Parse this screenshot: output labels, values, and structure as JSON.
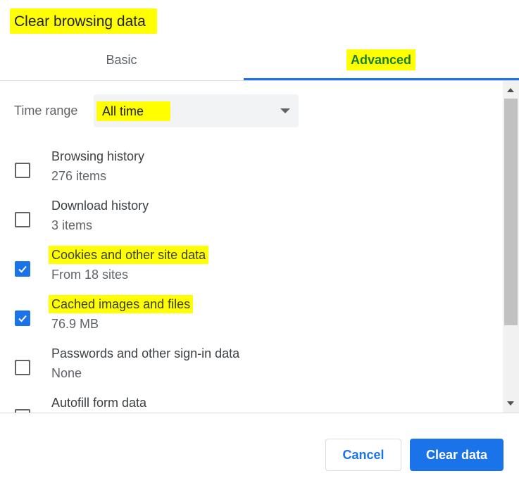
{
  "dialog": {
    "title": "Clear browsing data"
  },
  "tabs": [
    {
      "label": "Basic",
      "selected": false
    },
    {
      "label": "Advanced",
      "selected": true
    }
  ],
  "time_range": {
    "label": "Time range",
    "value": "All time"
  },
  "items": [
    {
      "label": "Browsing history",
      "detail": "276 items",
      "checked": false
    },
    {
      "label": "Download history",
      "detail": "3 items",
      "checked": false
    },
    {
      "label": "Cookies and other site data",
      "detail": "From 18 sites",
      "checked": true
    },
    {
      "label": "Cached images and files",
      "detail": "76.9 MB",
      "checked": true
    },
    {
      "label": "Passwords and other sign-in data",
      "detail": "None",
      "checked": false
    },
    {
      "label": "Autofill form data",
      "detail": "",
      "checked": false
    }
  ],
  "buttons": {
    "cancel": "Cancel",
    "clear": "Clear data"
  },
  "colors": {
    "accent": "#1a73e8",
    "highlight": "#ffff00",
    "advanced_text": "#1a7f37"
  },
  "icons": {
    "checkbox_checked": "check-icon",
    "dropdown": "caret-down-icon"
  }
}
